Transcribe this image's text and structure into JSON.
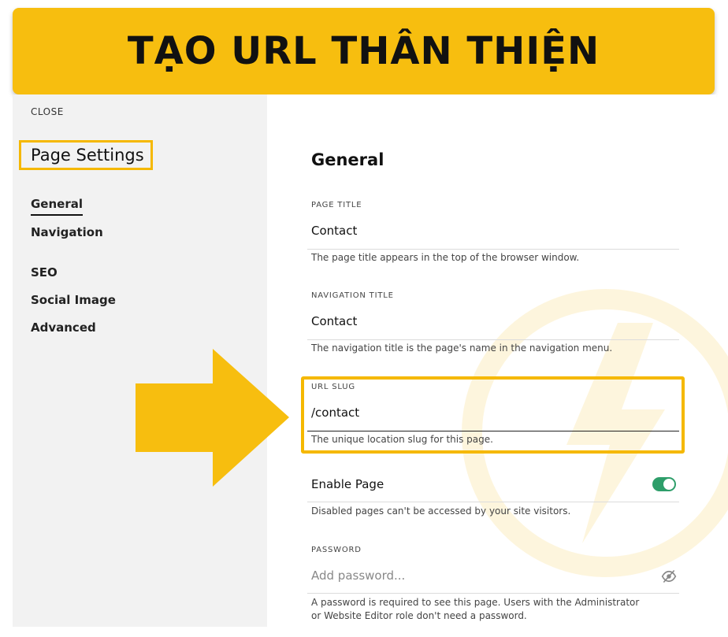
{
  "banner": {
    "title": "TẠO URL THÂN THIỆN"
  },
  "sidebar": {
    "close_label": "CLOSE",
    "title": "Page Settings",
    "items": [
      {
        "label": "General",
        "active": true
      },
      {
        "label": "Navigation"
      },
      {
        "label": "SEO"
      },
      {
        "label": "Social Image"
      },
      {
        "label": "Advanced"
      }
    ]
  },
  "main": {
    "heading": "General",
    "page_title": {
      "label": "PAGE TITLE",
      "value": "Contact",
      "help": "The page title appears in the top of the browser window."
    },
    "navigation_title": {
      "label": "NAVIGATION TITLE",
      "value": "Contact",
      "help": "The navigation title is the page's name in the navigation menu."
    },
    "url_slug": {
      "label": "URL SLUG",
      "value": "/contact",
      "help": "The unique location slug for this page."
    },
    "enable_page": {
      "label": "Enable Page",
      "enabled": true,
      "help": "Disabled pages can't be accessed by your site visitors."
    },
    "password": {
      "label": "PASSWORD",
      "placeholder": "Add password...",
      "help": "A password is required to see this page. Users with the Administrator or Website Editor role don't need a password."
    }
  },
  "colors": {
    "highlight": "#F5B800",
    "banner": "#F7BE0F",
    "toggle_on": "#2e9e6a",
    "sidebar_bg": "#f2f2f2"
  },
  "icons": {
    "arrow": "right-arrow-icon",
    "password_visibility": "eye-slash-icon"
  }
}
